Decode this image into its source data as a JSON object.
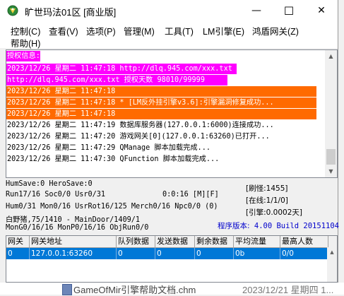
{
  "window": {
    "title": "旷世玛法01区 [商业版]",
    "controls": {
      "minimize": "—",
      "maximize": "☐",
      "close": "✕"
    }
  },
  "menu": [
    {
      "label": "控制(C)"
    },
    {
      "label": "查看(V)"
    },
    {
      "label": "选项(P)"
    },
    {
      "label": "管理(M)"
    },
    {
      "label": "工具(T)"
    },
    {
      "label": "LM引擎(E)"
    },
    {
      "label": "鸿盾网关(Z)"
    },
    {
      "label": "帮助(H)"
    }
  ],
  "log": [
    {
      "text": "授权信息:",
      "fg": "#ffffff",
      "bg": "#ff00ff"
    },
    {
      "text": "2023/12/26 星期二 11:47:18 http://dlq.945.com/xxx.txt",
      "fg": "#ffffff",
      "bg": "#ff00ff"
    },
    {
      "text": "http://dlq.945.com/xxx.txt 授权天数 98010/99999",
      "fg": "#ffffff",
      "bg": "#ff00ff"
    },
    {
      "text": "2023/12/26 星期二 11:47:18",
      "fg": "#ffffff",
      "bg": "#ff6a00"
    },
    {
      "text": "2023/12/26 星期二 11:47:18 * [LM反外挂引擎v3.6]:引擎漏洞修复成功...",
      "fg": "#ffffff",
      "bg": "#ff6a00"
    },
    {
      "text": "2023/12/26 星期二 11:47:18",
      "fg": "#ffffff",
      "bg": "#ff6a00"
    },
    {
      "text": "2023/12/26 星期二 11:47:19 数据库服务器(127.0.0.1:6000)连接成功...",
      "fg": "#000000",
      "bg": ""
    },
    {
      "text": "2023/12/26 星期二 11:47:20 游戏网关[0](127.0.0.1:63260)已打开...",
      "fg": "#000000",
      "bg": ""
    },
    {
      "text": "2023/12/26 星期二 11:47:29 QManage 脚本加载完成...",
      "fg": "#000000",
      "bg": ""
    },
    {
      "text": "2023/12/26 星期二 11:47:30 QFunction 脚本加载完成...",
      "fg": "#000000",
      "bg": ""
    }
  ],
  "status": {
    "line1": "HumSave:0 HeroSave:0",
    "line2": "Run17/16 Soc0/0 Usr0/31",
    "line2_time": "0:0:16 [M][F]",
    "line3": "Hum0/31 Mon0/16 UsrRot16/125 Merch0/16 Npc0/0 (0)",
    "line4": "白野猪,75/1410 - MainDoor/1409/1",
    "line5": "MonG0/16/16 MonP0/16/16 ObjRun0/0",
    "refresh": "刷怪:1455",
    "online": "在线:1/1/0",
    "engine": "引擎:0.0002天",
    "version_label": "程序版本:",
    "version_value": "4.00 Build 20151104"
  },
  "grid": {
    "columns": [
      "网关",
      "网关地址",
      "队列数据",
      "发送数据",
      "剩余数据",
      "平均流量",
      "最高人数"
    ],
    "rows": [
      [
        "0",
        "127.0.0.1:63260",
        "0",
        "0",
        "0",
        "0b",
        "0/0"
      ]
    ]
  },
  "background": {
    "filename": "GameOfMir引擎帮助文档.chm",
    "date": "2023/12/21 星期四 1..."
  }
}
